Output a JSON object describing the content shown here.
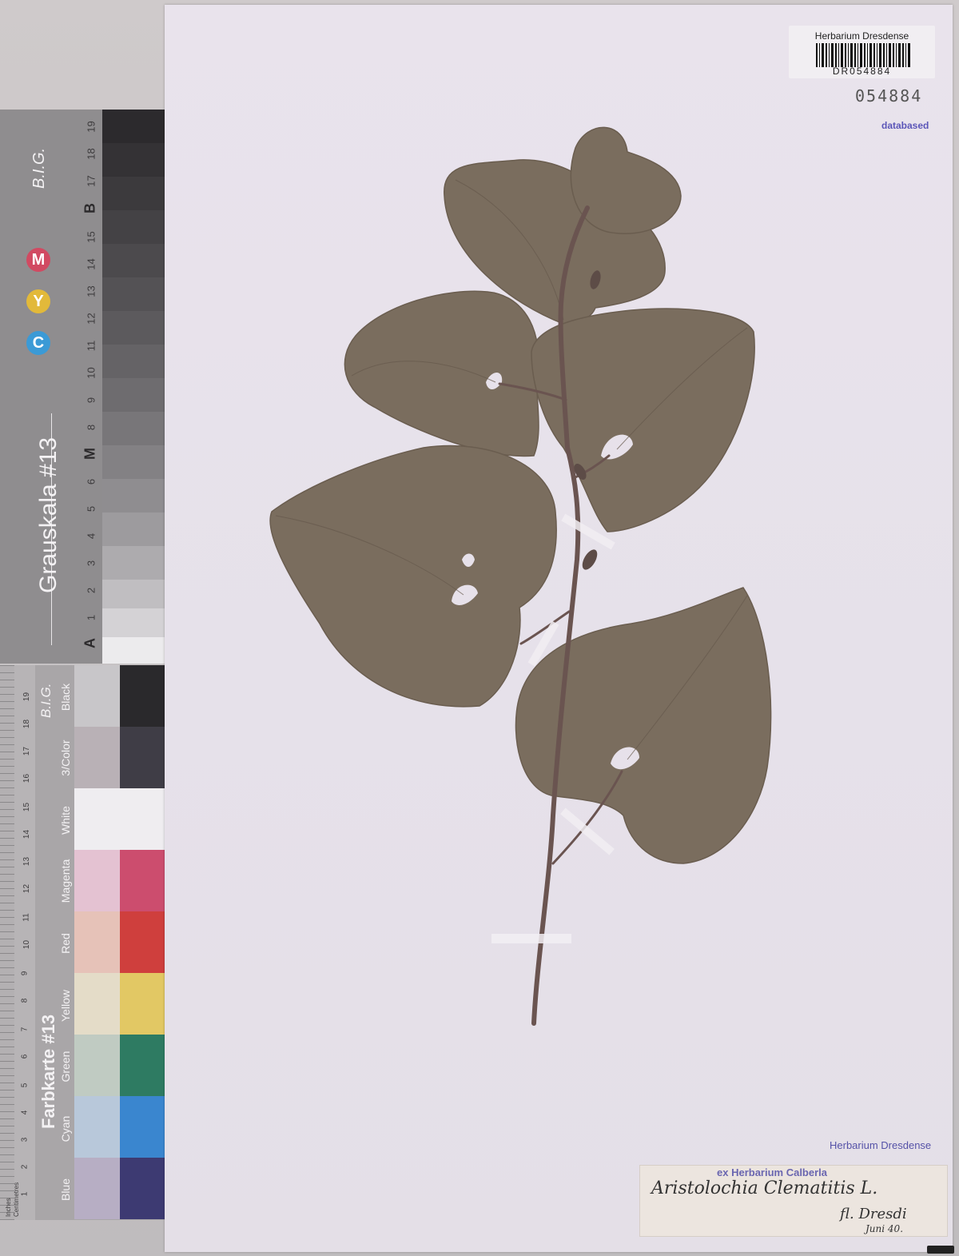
{
  "grey_scale_card": {
    "title": "Grauskala #13",
    "brand": "B.I.G.",
    "cym": [
      "C",
      "Y",
      "M"
    ],
    "scale_numbers": [
      "1",
      "2",
      "3",
      "4",
      "5",
      "6",
      "8",
      "9",
      "10",
      "11",
      "12",
      "13",
      "14",
      "15",
      "17",
      "18",
      "19"
    ],
    "scale_letters": [
      "A",
      "M",
      "B"
    ]
  },
  "color_card": {
    "title": "Farbkarte #13",
    "brand": "B.I.G.",
    "swatch_labels": [
      "Black",
      "3/Color",
      "White",
      "Magenta",
      "Red",
      "Yellow",
      "Green",
      "Cyan",
      "Blue"
    ],
    "ruler_numbers": [
      "19",
      "18",
      "17",
      "16",
      "15",
      "14",
      "13",
      "12",
      "11",
      "10",
      "9",
      "8",
      "7",
      "6",
      "5",
      "4",
      "3",
      "2",
      "1"
    ],
    "ruler_units": [
      "Inches",
      "Centimetres"
    ]
  },
  "sheet": {
    "barcode_label": {
      "institution": "Herbarium Dresdense",
      "barcode_number": "DR054884"
    },
    "catalog_number": "054884",
    "databased_stamp": "databased",
    "herbarium_stamp": "Herbarium Dresdense",
    "ex_label": {
      "title": "ex Herbarium Calberla",
      "script_name": "Aristolochia Clematitis L.",
      "collector": "fl. Dresdi",
      "date": "Juni 40."
    }
  },
  "colors": {
    "leaf": "#7b6e5f",
    "stem": "#6a5450",
    "sheet": "#e8e2ea"
  }
}
